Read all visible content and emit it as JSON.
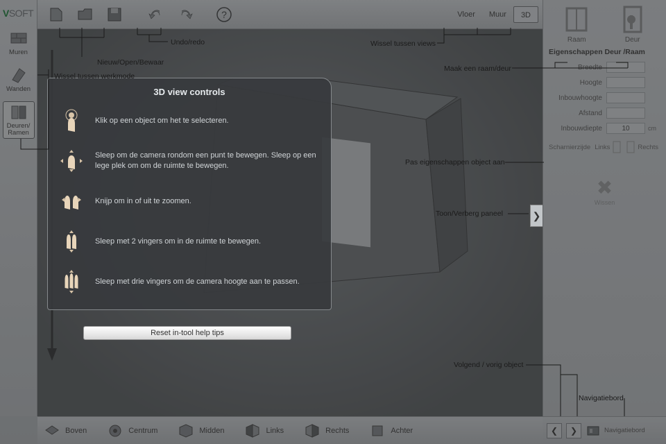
{
  "app_name_a": "V",
  "app_name_b": "SOFT",
  "left_tools": [
    {
      "id": "muren",
      "label": "Muren"
    },
    {
      "id": "wanden",
      "label": "Wanden"
    },
    {
      "id": "deuren",
      "label": "Deuren/\nRamen",
      "active": true
    }
  ],
  "view_tabs": [
    {
      "id": "vloer",
      "label": "Vloer"
    },
    {
      "id": "muur",
      "label": "Muur"
    },
    {
      "id": "3d",
      "label": "3D",
      "active": true
    }
  ],
  "right": {
    "elements": [
      {
        "id": "raam",
        "label": "Raam"
      },
      {
        "id": "deur",
        "label": "Deur"
      }
    ],
    "header": "Eigenschappen Deur /Raam",
    "props": [
      {
        "id": "breedte",
        "label": "Breedte",
        "value": "",
        "unit": ""
      },
      {
        "id": "hoogte",
        "label": "Hoogte",
        "value": "",
        "unit": ""
      },
      {
        "id": "inbouwhoogte",
        "label": "Inbouwhoogte",
        "value": "",
        "unit": ""
      },
      {
        "id": "afstand",
        "label": "Afstand",
        "value": "",
        "unit": ""
      },
      {
        "id": "inbouwdiepte",
        "label": "Inbouwdiepte",
        "value": "10",
        "unit": "cm"
      }
    ],
    "hinge_label": "Scharnierzijde",
    "hinge_left": "Links",
    "hinge_right": "Rechts",
    "delete_label": "Wissen"
  },
  "bottom_views": [
    {
      "id": "boven",
      "label": "Boven"
    },
    {
      "id": "centrum",
      "label": "Centrum"
    },
    {
      "id": "midden",
      "label": "Midden"
    },
    {
      "id": "links",
      "label": "Links"
    },
    {
      "id": "rechts",
      "label": "Rechts"
    },
    {
      "id": "achter",
      "label": "Achter"
    }
  ],
  "nav_label": "Navigatiebord",
  "collapse_glyph": "❯",
  "help": {
    "title": "3D view controls",
    "items": [
      "Klik op een object om het te selecteren.",
      "Sleep om de camera rondom een punt te bewegen. Sleep op een lege plek om om de ruimte te bewegen.",
      "Knijp om in of uit te zoomen.",
      "Sleep met 2 vingers om in de ruimte te bewegen.",
      "Sleep met drie vingers om de camera hoogte aan te passen."
    ],
    "reset": "Reset in-tool help tips"
  },
  "callouts": {
    "workmode": "Wissel tussen werkmode",
    "fileops": "Nieuw/Open/Bewaar",
    "undoredo": "Undo/redo",
    "views": "Wissel tussen views",
    "makedoor": "Maak een raam/deur",
    "propsadj": "Pas eigenschappen object aan",
    "togglepanel": "Toon/Verberg paneel",
    "nextprev": "Volgend / vorig object",
    "navboard": "Navigatiebord"
  }
}
